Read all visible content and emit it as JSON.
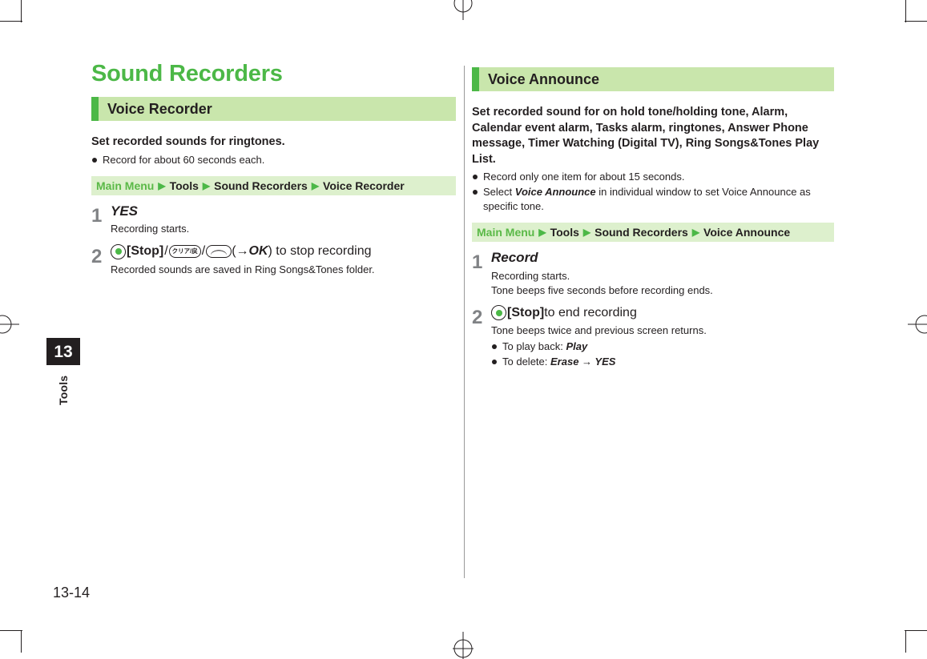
{
  "page": {
    "folio": "13-14",
    "chapter_number": "13",
    "chapter_label": "Tools",
    "accent_green": "#4cb847",
    "header_bg_green": "#c9e6ac",
    "breadcrumb_bg_green": "#ddf0cd",
    "text_color": "#231f20",
    "step_number_color": "#808285"
  },
  "left_column": {
    "chapter_title": "Sound Recorders",
    "section": {
      "title": "Voice Recorder",
      "lead": "Set recorded sounds for ringtones.",
      "bullets": [
        {
          "text": "Record for about 60 seconds each."
        }
      ],
      "breadcrumb": {
        "items": [
          "Main Menu",
          "Tools",
          "Sound Recorders",
          "Voice Recorder"
        ],
        "arrow": "▶"
      },
      "steps": [
        {
          "number": "1",
          "head": "YES",
          "notes": [
            "Recording starts."
          ]
        },
        {
          "number": "2",
          "head_parts": {
            "center_key_icon": "center-select-key-icon",
            "stop_label": "[Stop]",
            "slash_1": "/",
            "clear_key_icon": "clear-back-key-icon",
            "clear_key_text": "クリア/戻",
            "slash_2": "/",
            "end_key_icon": "end-call-key-icon",
            "suffix_open": " (",
            "arrow": "→ ",
            "ok_label": "OK",
            "suffix_close": ") to stop recording"
          },
          "notes": [
            "Recorded sounds are saved in Ring Songs&Tones folder."
          ]
        }
      ]
    }
  },
  "right_column": {
    "section": {
      "title": "Voice Announce",
      "lead": "Set recorded sound for on hold tone/holding tone, Alarm, Calendar event alarm, Tasks alarm, ringtones, Answer Phone message, Timer Watching (Digital TV), Ring Songs&Tones Play List.",
      "bullets": [
        {
          "text": "Record only one item for about 15 seconds."
        },
        {
          "prefix": "Select ",
          "emphasis": "Voice Announce",
          "suffix": " in individual window to set Voice Announce as specific tone."
        }
      ],
      "breadcrumb": {
        "items": [
          "Main Menu",
          "Tools",
          "Sound Recorders",
          "Voice Announce"
        ],
        "arrow": "▶"
      },
      "steps": [
        {
          "number": "1",
          "head": "Record",
          "notes": [
            "Recording starts.",
            "Tone beeps five seconds before recording ends."
          ]
        },
        {
          "number": "2",
          "head_parts": {
            "center_key_icon": "center-select-key-icon",
            "stop_label": "[Stop]",
            "suffix": " to end recording"
          },
          "notes": [
            "Tone beeps twice and previous screen returns."
          ],
          "sub_bullets": [
            {
              "prefix": "To play back: ",
              "emphasis": "Play"
            },
            {
              "prefix": "To delete: ",
              "emphasis": "Erase",
              "arrow": " → ",
              "emphasis2": "YES"
            }
          ]
        }
      ]
    }
  }
}
